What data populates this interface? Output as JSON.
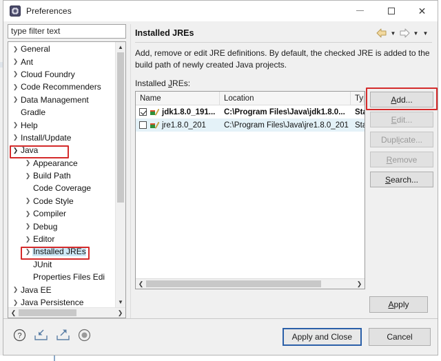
{
  "window": {
    "title": "Preferences",
    "app_icon": "preferences-gear-icon",
    "controls": {
      "minimize": "–",
      "maximize": "□",
      "close": "✕"
    }
  },
  "sidebar": {
    "filter": {
      "placeholder": "type filter text",
      "value": "type filter text"
    },
    "items": [
      {
        "label": "General",
        "level": 1,
        "arrow": "collapsed"
      },
      {
        "label": "Ant",
        "level": 1,
        "arrow": "collapsed"
      },
      {
        "label": "Cloud Foundry",
        "level": 1,
        "arrow": "collapsed"
      },
      {
        "label": "Code Recommenders",
        "level": 1,
        "arrow": "collapsed"
      },
      {
        "label": "Data Management",
        "level": 1,
        "arrow": "collapsed"
      },
      {
        "label": "Gradle",
        "level": 1,
        "arrow": "none"
      },
      {
        "label": "Help",
        "level": 1,
        "arrow": "collapsed"
      },
      {
        "label": "Install/Update",
        "level": 1,
        "arrow": "collapsed"
      },
      {
        "label": "Java",
        "level": 1,
        "arrow": "expanded",
        "highlighted": true
      },
      {
        "label": "Appearance",
        "level": 2,
        "arrow": "collapsed"
      },
      {
        "label": "Build Path",
        "level": 2,
        "arrow": "collapsed"
      },
      {
        "label": "Code Coverage",
        "level": 2,
        "arrow": "none"
      },
      {
        "label": "Code Style",
        "level": 2,
        "arrow": "collapsed"
      },
      {
        "label": "Compiler",
        "level": 2,
        "arrow": "collapsed"
      },
      {
        "label": "Debug",
        "level": 2,
        "arrow": "collapsed"
      },
      {
        "label": "Editor",
        "level": 2,
        "arrow": "collapsed"
      },
      {
        "label": "Installed JREs",
        "level": 2,
        "arrow": "collapsed",
        "selected": true,
        "highlighted": true
      },
      {
        "label": "JUnit",
        "level": 2,
        "arrow": "none"
      },
      {
        "label": "Properties Files Edi",
        "level": 2,
        "arrow": "none"
      },
      {
        "label": "Java EE",
        "level": 1,
        "arrow": "collapsed"
      },
      {
        "label": "Java Persistence",
        "level": 1,
        "arrow": "collapsed"
      }
    ],
    "scroll_up_icon": "chevron-up-icon",
    "scroll_down_icon": "chevron-down-icon",
    "scroll_left_icon": "chevron-left-icon",
    "scroll_right_icon": "chevron-right-icon"
  },
  "page": {
    "title": "Installed JREs",
    "nav": {
      "back_icon": "arrow-back-icon",
      "back_menu_icon": "caret-down-icon",
      "forward_icon": "arrow-forward-icon",
      "forward_menu_icon": "caret-down-icon",
      "menu_icon": "caret-down-icon"
    },
    "description": "Add, remove or edit JRE definitions. By default, the checked JRE is added to the build path of newly created Java projects.",
    "list_label": "Installed JREs:",
    "table": {
      "columns": [
        "Name",
        "Location",
        "Typ"
      ],
      "rows": [
        {
          "checked": true,
          "selected": false,
          "icon": "jre-icon",
          "name": "jdk1.8.0_191...",
          "location": "C:\\Program Files\\Java\\jdk1.8.0...",
          "type": "Sta"
        },
        {
          "checked": false,
          "selected": true,
          "icon": "jre-icon",
          "name": "jre1.8.0_201",
          "location": "C:\\Program Files\\Java\\jre1.8.0_201",
          "type": "Sta"
        }
      ]
    },
    "side_buttons": [
      {
        "label": "Add...",
        "accesskey": "A",
        "disabled": false,
        "highlighted": true
      },
      {
        "label": "Edit...",
        "accesskey": "E",
        "disabled": true,
        "highlighted": false
      },
      {
        "label": "Duplicate...",
        "accesskey": "i",
        "disabled": true,
        "highlighted": false
      },
      {
        "label": "Remove",
        "accesskey": "R",
        "disabled": true,
        "highlighted": false
      },
      {
        "label": "Search...",
        "accesskey": "S",
        "disabled": false,
        "highlighted": false
      }
    ],
    "apply_button": "Apply"
  },
  "footer": {
    "icons": [
      {
        "name": "help-icon",
        "glyph": "?"
      },
      {
        "name": "import-icon",
        "glyph": "import"
      },
      {
        "name": "export-icon",
        "glyph": "export"
      },
      {
        "name": "record-icon",
        "glyph": "record"
      }
    ],
    "apply_and_close": "Apply and Close",
    "cancel": "Cancel"
  },
  "colors": {
    "annotation_red": "#d42a2a",
    "focus_blue": "#2a5fa8",
    "selection_blue": "#cde8f6",
    "row_selection": "#e4f2f8",
    "dialog_bg": "#f0f0f0",
    "button_bg": "#e1e1e1"
  }
}
